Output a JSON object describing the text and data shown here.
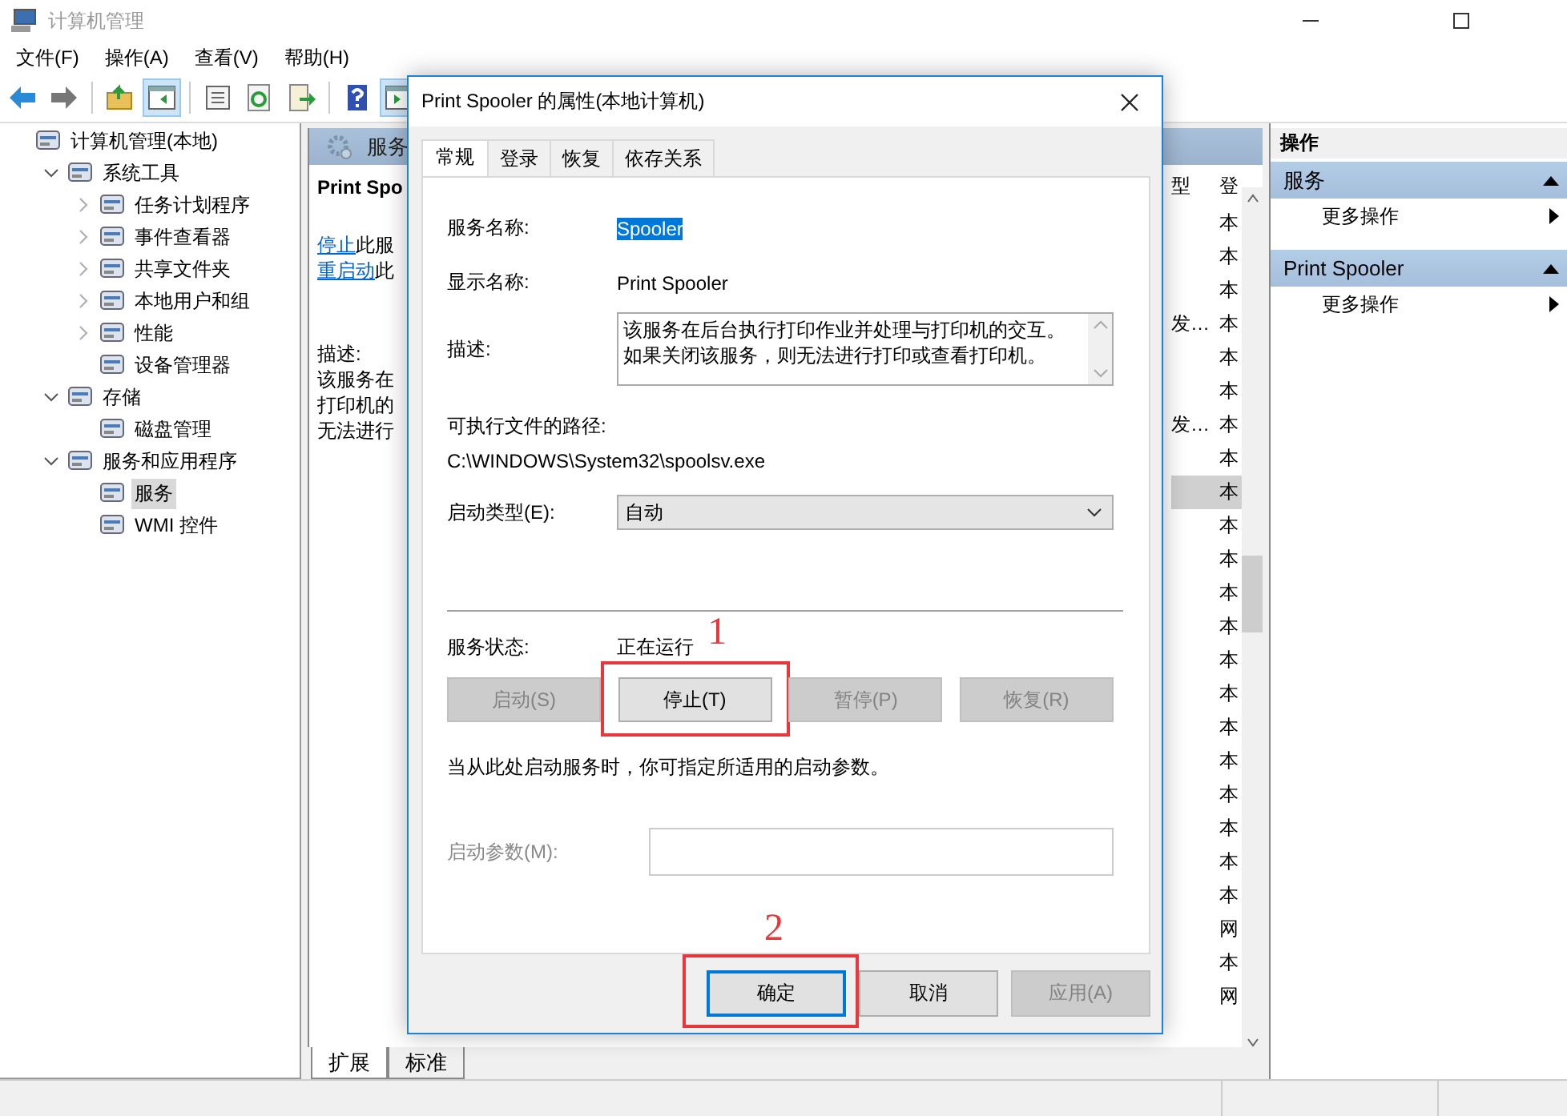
{
  "window": {
    "title": "计算机管理"
  },
  "menu": [
    "文件(F)",
    "操作(A)",
    "查看(V)",
    "帮助(H)"
  ],
  "toolbar": [
    {
      "kind": "back",
      "pressed": false
    },
    {
      "kind": "forward",
      "pressed": false
    },
    {
      "kind": "separator"
    },
    {
      "kind": "up",
      "pressed": false
    },
    {
      "kind": "tree-toggle",
      "pressed": true
    },
    {
      "kind": "separator"
    },
    {
      "kind": "properties",
      "pressed": false
    },
    {
      "kind": "refresh",
      "pressed": false
    },
    {
      "kind": "export",
      "pressed": false
    },
    {
      "kind": "separator"
    },
    {
      "kind": "help",
      "pressed": false
    },
    {
      "kind": "pane-toggle",
      "pressed": true
    }
  ],
  "tree": [
    {
      "label": "计算机管理(本地)",
      "selected": false,
      "children": [
        {
          "label": "系统工具",
          "expanded": true,
          "selected": false,
          "children": [
            {
              "label": "任务计划程序",
              "expanded": false,
              "selected": false
            },
            {
              "label": "事件查看器",
              "expanded": false,
              "selected": false
            },
            {
              "label": "共享文件夹",
              "expanded": false,
              "selected": false
            },
            {
              "label": "本地用户和组",
              "expanded": false,
              "selected": false
            },
            {
              "label": "性能",
              "expanded": false,
              "selected": false
            },
            {
              "label": "设备管理器",
              "selected": false
            }
          ]
        },
        {
          "label": "存储",
          "expanded": true,
          "selected": false,
          "children": [
            {
              "label": "磁盘管理",
              "selected": false
            }
          ]
        },
        {
          "label": "服务和应用程序",
          "expanded": true,
          "selected": false,
          "children": [
            {
              "label": "服务",
              "selected": true
            },
            {
              "label": "WMI 控件",
              "selected": false
            }
          ]
        }
      ]
    }
  ],
  "middle": {
    "header": "服务",
    "detail": {
      "title": "Print Spo",
      "actions": [
        {
          "link": "停止",
          "rest": "此服"
        },
        {
          "link": "重启动",
          "rest": "此"
        }
      ],
      "desc_label": "描述:",
      "desc_lines": [
        "该服务在",
        "打印机的",
        "无法进行"
      ]
    },
    "list": {
      "columns": [
        "型",
        "登"
      ],
      "rows": [
        {
          "type": "",
          "logon": "本",
          "selected": false
        },
        {
          "type": "",
          "logon": "本",
          "selected": false
        },
        {
          "type": "",
          "logon": "本",
          "selected": false
        },
        {
          "type": "发…",
          "logon": "本",
          "selected": false
        },
        {
          "type": "",
          "logon": "本",
          "selected": false
        },
        {
          "type": "",
          "logon": "本",
          "selected": false
        },
        {
          "type": "发…",
          "logon": "本",
          "selected": false
        },
        {
          "type": "",
          "logon": "本",
          "selected": false
        },
        {
          "type": "",
          "logon": "本",
          "selected": true
        },
        {
          "type": "",
          "logon": "本",
          "selected": false
        },
        {
          "type": "",
          "logon": "本",
          "selected": false
        },
        {
          "type": "",
          "logon": "本",
          "selected": false
        },
        {
          "type": "",
          "logon": "本",
          "selected": false
        },
        {
          "type": "",
          "logon": "本",
          "selected": false
        },
        {
          "type": "",
          "logon": "本",
          "selected": false
        },
        {
          "type": "",
          "logon": "本",
          "selected": false
        },
        {
          "type": "",
          "logon": "本",
          "selected": false
        },
        {
          "type": "",
          "logon": "本",
          "selected": false
        },
        {
          "type": "",
          "logon": "本",
          "selected": false
        },
        {
          "type": "",
          "logon": "本",
          "selected": false
        },
        {
          "type": "",
          "logon": "本",
          "selected": false
        },
        {
          "type": "",
          "logon": "网",
          "selected": false
        },
        {
          "type": "",
          "logon": "本",
          "selected": false
        },
        {
          "type": "",
          "logon": "网",
          "selected": false
        }
      ]
    },
    "tabs": [
      {
        "label": "扩展",
        "selected": true
      },
      {
        "label": "标准",
        "selected": false
      }
    ]
  },
  "actions": {
    "header": "操作",
    "groups": [
      {
        "title": "服务",
        "items": [
          "更多操作"
        ]
      },
      {
        "title": "Print Spooler",
        "items": [
          "更多操作"
        ]
      }
    ]
  },
  "dialog": {
    "title": "Print Spooler 的属性(本地计算机)",
    "tabs": [
      {
        "label": "常规",
        "selected": true
      },
      {
        "label": "登录",
        "selected": false
      },
      {
        "label": "恢复",
        "selected": false
      },
      {
        "label": "依存关系",
        "selected": false
      }
    ],
    "service_name_label": "服务名称:",
    "service_name": "Spooler",
    "display_name_label": "显示名称:",
    "display_name": "Print Spooler",
    "description_label": "描述:",
    "description": "该服务在后台执行打印作业并处理与打印机的交互。如果关闭该服务，则无法进行打印或查看打印机。",
    "path_label": "可执行文件的路径:",
    "path": "C:\\WINDOWS\\System32\\spoolsv.exe",
    "startup_type_label": "启动类型(E):",
    "startup_type": "自动",
    "status_label": "服务状态:",
    "status": "正在运行",
    "service_buttons": [
      {
        "label": "启动(S)",
        "disabled": true
      },
      {
        "label": "停止(T)",
        "disabled": false,
        "annotation": "1"
      },
      {
        "label": "暂停(P)",
        "disabled": true
      },
      {
        "label": "恢复(R)",
        "disabled": true
      }
    ],
    "hint": "当从此处启动服务时，你可指定所适用的启动参数。",
    "params_label": "启动参数(M):",
    "params_disabled": true,
    "buttons": [
      {
        "label": "确定",
        "disabled": false,
        "default": true,
        "annotation": "2"
      },
      {
        "label": "取消",
        "disabled": false,
        "default": false
      },
      {
        "label": "应用(A)",
        "disabled": true,
        "default": false
      }
    ]
  }
}
